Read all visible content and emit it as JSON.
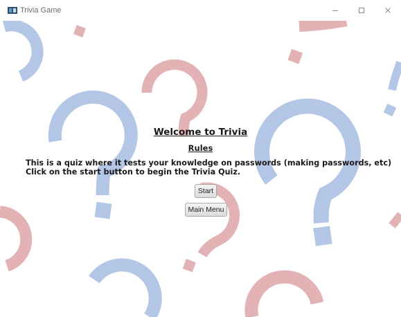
{
  "window": {
    "title": "Trivia Game",
    "controls": {
      "minimize_icon": "minimize-icon",
      "maximize_icon": "maximize-icon",
      "close_icon": "close-icon"
    }
  },
  "main": {
    "heading": "Welcome to Trivia",
    "subheading": "Rules",
    "description_line1": "This is a quiz where it tests your knowledge on passwords (making passwords, etc)",
    "description_line2": "Click on the start button to begin the Trivia Quiz.",
    "start_label": "Start",
    "main_menu_label": "Main Menu"
  },
  "colors": {
    "question_blue": "#b4c6e5",
    "question_red": "#e2b2b5",
    "text": "#1a1a1a"
  }
}
